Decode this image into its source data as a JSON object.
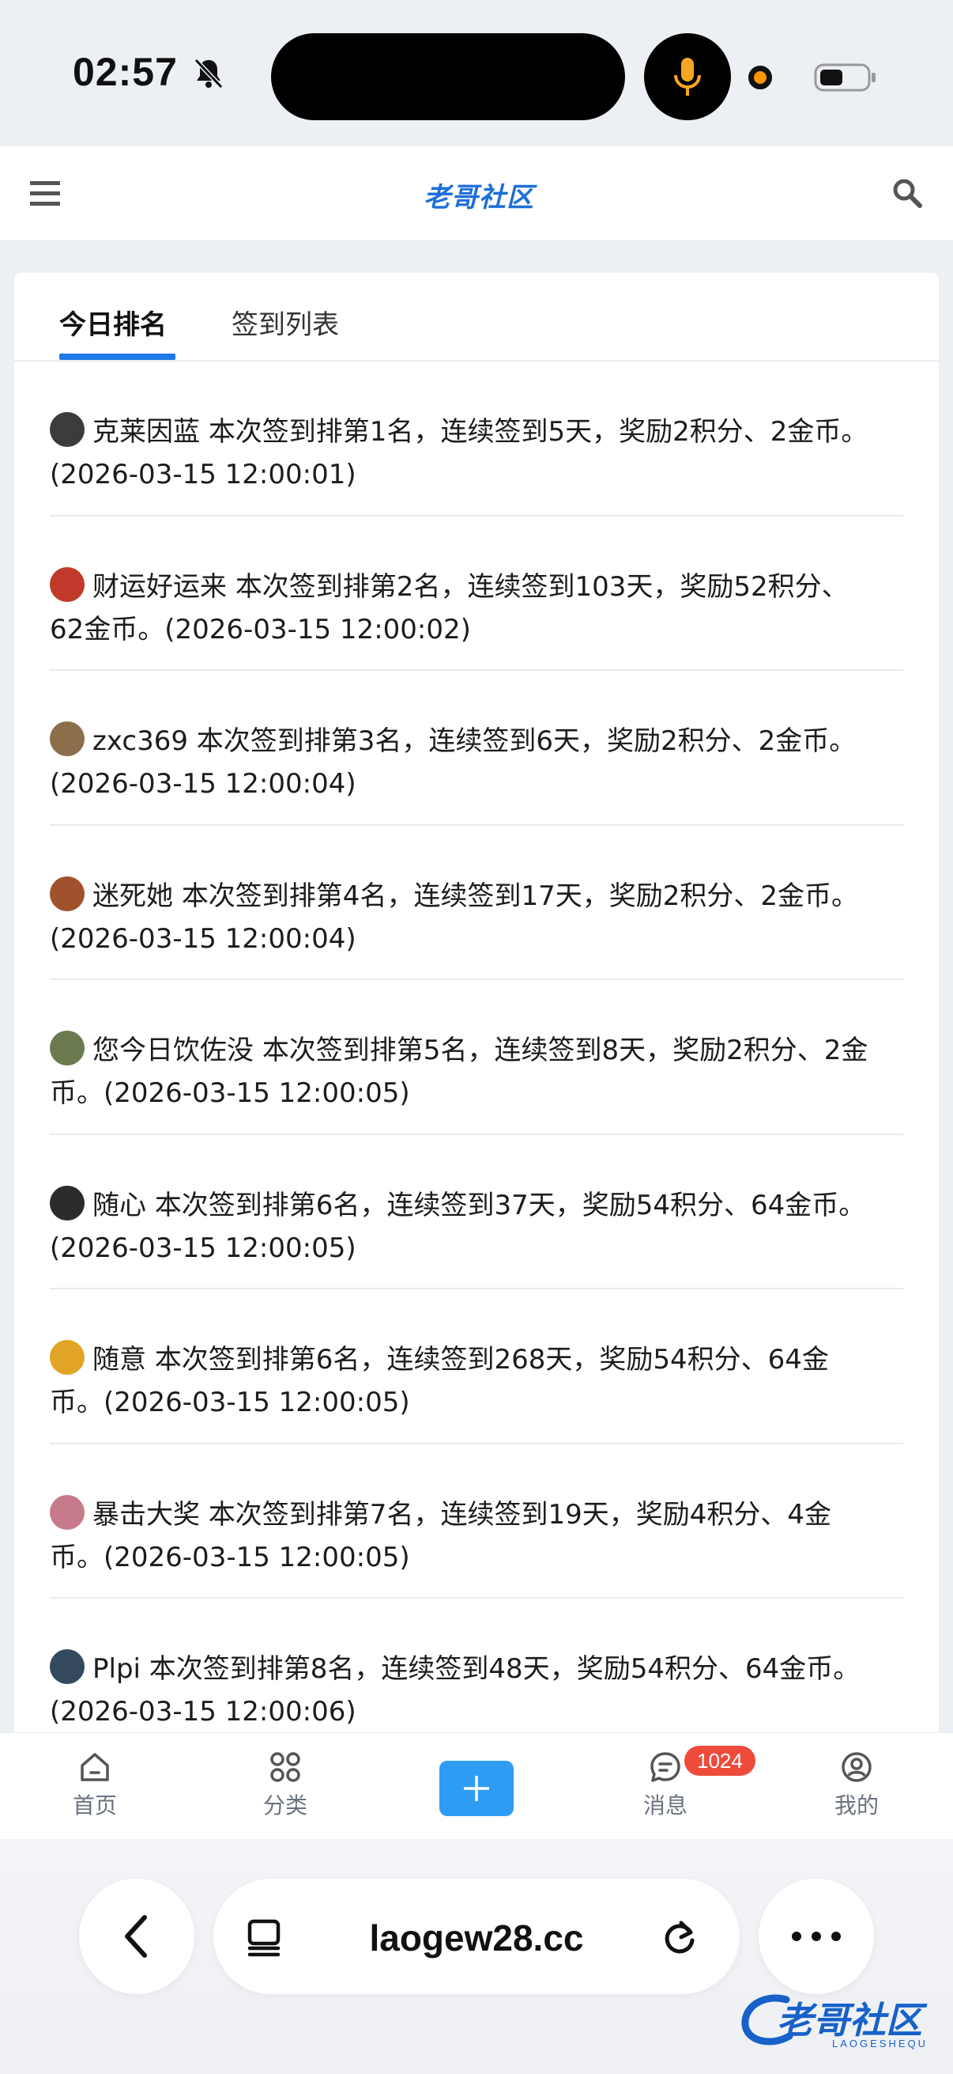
{
  "status_bar": {
    "time": "02:57"
  },
  "header": {
    "logo_text": "老哥社区"
  },
  "tabs": [
    {
      "label": "今日排名",
      "active": true
    },
    {
      "label": "签到列表",
      "active": false
    }
  ],
  "list": [
    {
      "name": "克莱因蓝",
      "line1": "本次签到排第1名，连续签到5天，奖励2积分、2金币。",
      "line2": "(2026-03-15 12:00:01)",
      "avatar_color": "#3b3b3b"
    },
    {
      "name": "财运好运来",
      "line1": "本次签到排第2名，连续签到103天，奖励52积分、",
      "line2": "62金币。(2026-03-15 12:00:02)",
      "avatar_color": "#c0392b"
    },
    {
      "name": "zxc369",
      "line1": "本次签到排第3名，连续签到6天，奖励2积分、2金币。",
      "line2": "(2026-03-15 12:00:04)",
      "avatar_color": "#8d6e4a"
    },
    {
      "name": "迷死她",
      "line1": "本次签到排第4名，连续签到17天，奖励2积分、2金币。",
      "line2": "(2026-03-15 12:00:04)",
      "avatar_color": "#a0522d"
    },
    {
      "name": "您今日饮佐没",
      "line1": "本次签到排第5名，连续签到8天，奖励2积分、2金",
      "line2": "币。(2026-03-15 12:00:05)",
      "avatar_color": "#6b7a4f"
    },
    {
      "name": "随心",
      "line1": "本次签到排第6名，连续签到37天，奖励54积分、64金币。",
      "line2": "(2026-03-15 12:00:05)",
      "avatar_color": "#2c2c2c"
    },
    {
      "name": "随意",
      "line1": "本次签到排第6名，连续签到268天，奖励54积分、64金",
      "line2": "币。(2026-03-15 12:00:05)",
      "avatar_color": "#e0a526"
    },
    {
      "name": "暴击大奖",
      "line1": "本次签到排第7名，连续签到19天，奖励4积分、4金",
      "line2": "币。(2026-03-15 12:00:05)",
      "avatar_color": "#c77a8a"
    },
    {
      "name": "Plpi",
      "line1": "本次签到排第8名，连续签到48天，奖励54积分、64金币。",
      "line2": "(2026-03-15 12:00:06)",
      "avatar_color": "#34495e"
    }
  ],
  "bottom_nav": {
    "home": "首页",
    "category": "分类",
    "messages": "消息",
    "messages_badge": "1024",
    "mine": "我的"
  },
  "browser": {
    "url": "laogew28.cc"
  },
  "watermark": {
    "text": "老哥社区",
    "sub": "LAOGESHEQU"
  },
  "colors": {
    "accent": "#1e78e6",
    "badge": "#ee4b3b",
    "add_button": "#2f9cf4"
  }
}
